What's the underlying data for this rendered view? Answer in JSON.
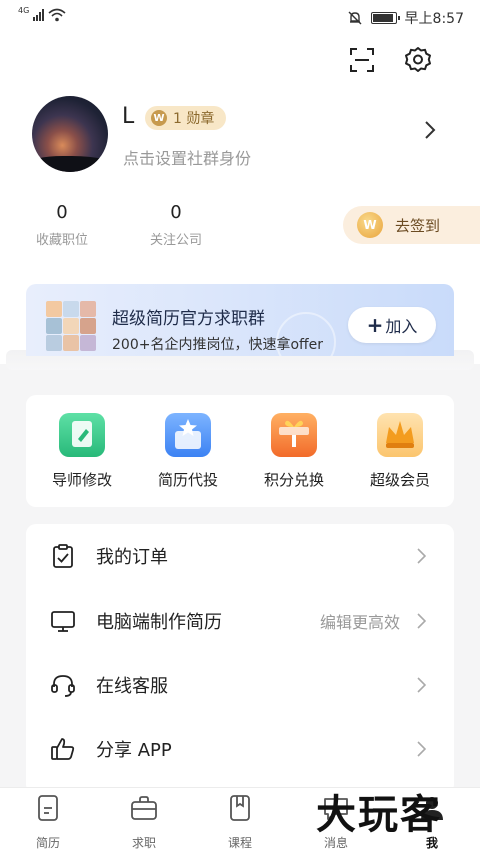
{
  "status_bar": {
    "network": "4G",
    "time": "早上8:57",
    "battery_level": 0.85
  },
  "profile": {
    "name": "L",
    "medal": "1 勋章",
    "medal_icon": "W",
    "subtitle": "点击设置社群身份",
    "stats": [
      {
        "value": "0",
        "label": "收藏职位"
      },
      {
        "value": "0",
        "label": "关注公司"
      }
    ],
    "checkin": "去签到",
    "checkin_icon": "W"
  },
  "banner": {
    "title": "超级简历官方求职群",
    "description": "200+名企内推岗位，快速拿offer",
    "join_plus": "+",
    "join_label": "加入"
  },
  "services": [
    {
      "label": "导师修改",
      "icon": "mentor-edit-icon",
      "color": "#34c98a"
    },
    {
      "label": "简历代投",
      "icon": "resume-delivery-icon",
      "color": "#4b8ff5"
    },
    {
      "label": "积分兑换",
      "icon": "gift-icon",
      "color": "#f6842f"
    },
    {
      "label": "超级会员",
      "icon": "crown-icon",
      "color": "#f7a53a"
    }
  ],
  "menu": [
    {
      "label": "我的订单",
      "hint": "",
      "icon": "order-clipboard-icon"
    },
    {
      "label": "电脑端制作简历",
      "hint": "编辑更高效",
      "icon": "monitor-icon"
    },
    {
      "label": "在线客服",
      "hint": "",
      "icon": "headset-icon"
    },
    {
      "label": "分享 APP",
      "hint": "",
      "icon": "thumbs-up-icon"
    }
  ],
  "tabs": [
    {
      "label": "简历",
      "icon": "resume-doc-icon"
    },
    {
      "label": "求职",
      "icon": "briefcase-icon"
    },
    {
      "label": "课程",
      "icon": "book-icon"
    },
    {
      "label": "消息",
      "icon": "message-icon"
    },
    {
      "label": "我",
      "icon": "me-icon"
    }
  ],
  "watermark": "大玩客",
  "colors": {
    "medal_bg": "#f8e7c7",
    "checkin_bg": "#fbeede",
    "banner_blue": "#c9dbfa"
  }
}
